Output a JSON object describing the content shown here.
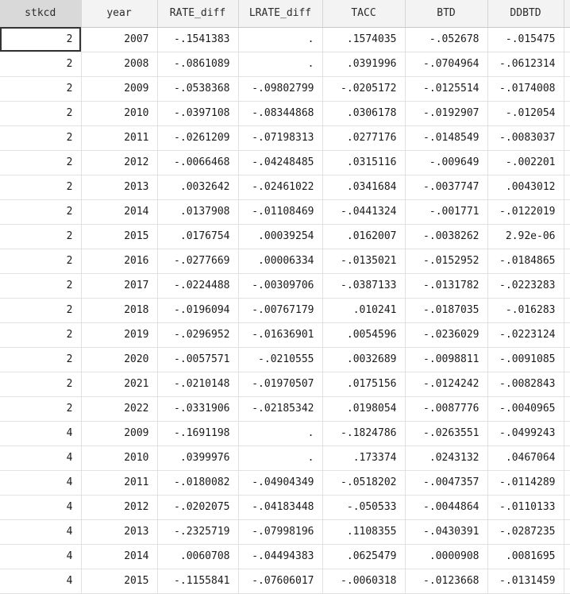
{
  "columns": [
    "stkcd",
    "year",
    "RATE_diff",
    "LRATE_diff",
    "TACC",
    "BTD",
    "DDBTD"
  ],
  "rows": [
    [
      "2",
      "2007",
      "-.1541383",
      ".",
      ".1574035",
      "-.052678",
      "-.015475"
    ],
    [
      "2",
      "2008",
      "-.0861089",
      ".",
      ".0391996",
      "-.0704964",
      "-.0612314"
    ],
    [
      "2",
      "2009",
      "-.0538368",
      "-.09802799",
      "-.0205172",
      "-.0125514",
      "-.0174008"
    ],
    [
      "2",
      "2010",
      "-.0397108",
      "-.08344868",
      ".0306178",
      "-.0192907",
      "-.012054"
    ],
    [
      "2",
      "2011",
      "-.0261209",
      "-.07198313",
      ".0277176",
      "-.0148549",
      "-.0083037"
    ],
    [
      "2",
      "2012",
      "-.0066468",
      "-.04248485",
      ".0315116",
      "-.009649",
      "-.002201"
    ],
    [
      "2",
      "2013",
      ".0032642",
      "-.02461022",
      ".0341684",
      "-.0037747",
      ".0043012"
    ],
    [
      "2",
      "2014",
      ".0137908",
      "-.01108469",
      "-.0441324",
      "-.001771",
      "-.0122019"
    ],
    [
      "2",
      "2015",
      ".0176754",
      ".00039254",
      ".0162007",
      "-.0038262",
      "2.92e-06"
    ],
    [
      "2",
      "2016",
      "-.0277669",
      ".00006334",
      "-.0135021",
      "-.0152952",
      "-.0184865"
    ],
    [
      "2",
      "2017",
      "-.0224488",
      "-.00309706",
      "-.0387133",
      "-.0131782",
      "-.0223283"
    ],
    [
      "2",
      "2018",
      "-.0196094",
      "-.00767179",
      ".010241",
      "-.0187035",
      "-.016283"
    ],
    [
      "2",
      "2019",
      "-.0296952",
      "-.01636901",
      ".0054596",
      "-.0236029",
      "-.0223124"
    ],
    [
      "2",
      "2020",
      "-.0057571",
      "-.0210555",
      ".0032689",
      "-.0098811",
      "-.0091085"
    ],
    [
      "2",
      "2021",
      "-.0210148",
      "-.01970507",
      ".0175156",
      "-.0124242",
      "-.0082843"
    ],
    [
      "2",
      "2022",
      "-.0331906",
      "-.02185342",
      ".0198054",
      "-.0087776",
      "-.0040965"
    ],
    [
      "4",
      "2009",
      "-.1691198",
      ".",
      "-.1824786",
      "-.0263551",
      "-.0499243"
    ],
    [
      "4",
      "2010",
      ".0399976",
      ".",
      ".173374",
      ".0243132",
      ".0467064"
    ],
    [
      "4",
      "2011",
      "-.0180082",
      "-.04904349",
      "-.0518202",
      "-.0047357",
      "-.0114289"
    ],
    [
      "4",
      "2012",
      "-.0202075",
      "-.04183448",
      "-.050533",
      "-.0044864",
      "-.0110133"
    ],
    [
      "4",
      "2013",
      "-.2325719",
      "-.07998196",
      ".1108355",
      "-.0430391",
      "-.0287235"
    ],
    [
      "4",
      "2014",
      ".0060708",
      "-.04494383",
      ".0625479",
      ".0000908",
      ".0081695"
    ],
    [
      "4",
      "2015",
      "-.1155841",
      "-.07606017",
      "-.0060318",
      "-.0123668",
      "-.0131459"
    ]
  ],
  "selected_column": 0,
  "active_row": 0
}
